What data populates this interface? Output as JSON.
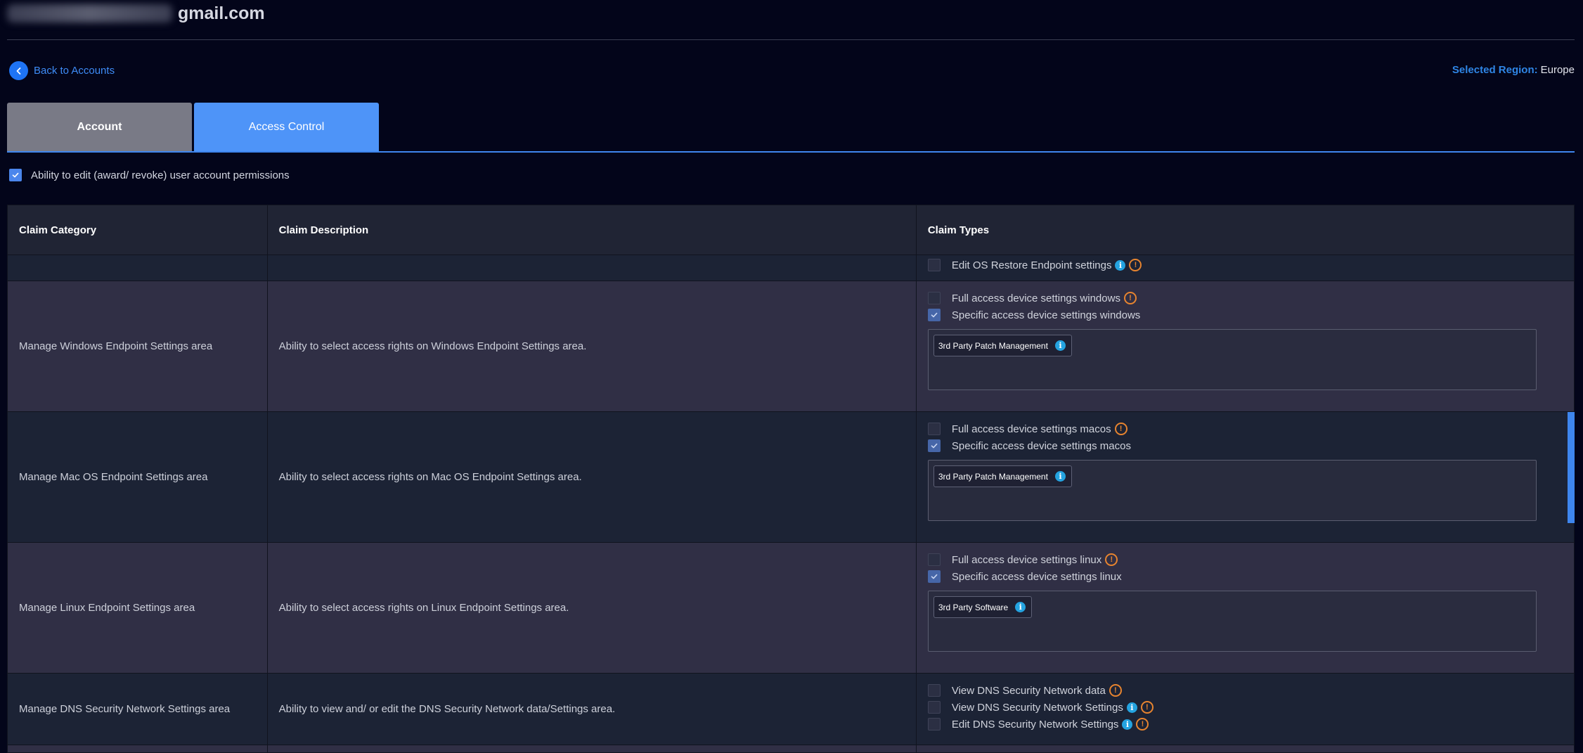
{
  "header": {
    "email_domain": "gmail.com"
  },
  "nav": {
    "back_label": "Back to Accounts",
    "region_label": "Selected Region:",
    "region_value": "Europe"
  },
  "tabs": [
    {
      "label": "Account",
      "active": false
    },
    {
      "label": "Access Control",
      "active": true
    }
  ],
  "permission": {
    "label": "Ability to edit (award/ revoke) user account permissions",
    "checked": true
  },
  "table": {
    "headers": [
      "Claim Category",
      "Claim Description",
      "Claim Types"
    ],
    "rows": [
      {
        "category": "",
        "description": "",
        "claims": [
          {
            "label": "Edit OS Restore Endpoint settings",
            "checked": false,
            "info": true,
            "warn": true
          }
        ]
      },
      {
        "category": "Manage Windows Endpoint Settings area",
        "description": "Ability to select access rights on Windows Endpoint Settings area.",
        "claims": [
          {
            "label": "Full access device settings windows",
            "checked": false,
            "info": false,
            "warn": true
          },
          {
            "label": "Specific access device settings windows",
            "checked": true,
            "info": false,
            "warn": false
          }
        ],
        "chips": [
          "3rd Party Patch Management"
        ]
      },
      {
        "category": "Manage Mac OS Endpoint Settings area",
        "description": "Ability to select access rights on Mac OS Endpoint Settings area.",
        "claims": [
          {
            "label": "Full access device settings macos",
            "checked": false,
            "info": false,
            "warn": true
          },
          {
            "label": "Specific access device settings macos",
            "checked": true,
            "info": false,
            "warn": false
          }
        ],
        "chips": [
          "3rd Party Patch Management"
        ]
      },
      {
        "category": "Manage Linux Endpoint Settings area",
        "description": "Ability to select access rights on Linux Endpoint Settings area.",
        "claims": [
          {
            "label": "Full access device settings linux",
            "checked": false,
            "info": false,
            "warn": true
          },
          {
            "label": "Specific access device settings linux",
            "checked": true,
            "info": false,
            "warn": false
          }
        ],
        "chips": [
          "3rd Party Software"
        ]
      },
      {
        "category": "Manage DNS Security Network Settings area",
        "description": "Ability to view and/ or edit the DNS Security Network data/Settings area.",
        "claims": [
          {
            "label": "View DNS Security Network data",
            "checked": false,
            "info": false,
            "warn": true
          },
          {
            "label": "View DNS Security Network Settings",
            "checked": false,
            "info": true,
            "warn": true
          },
          {
            "label": "Edit DNS Security Network Settings",
            "checked": false,
            "info": true,
            "warn": true
          }
        ]
      }
    ]
  },
  "icons": {
    "back": "chevron-left-icon",
    "check": "checkmark-icon",
    "info": "info-icon",
    "warning": "warning-icon"
  },
  "colors": {
    "background": "#03051a",
    "accent": "#4e94f8",
    "link": "#3e8cf7",
    "warning": "#e7842f",
    "info": "#24a3e0"
  }
}
